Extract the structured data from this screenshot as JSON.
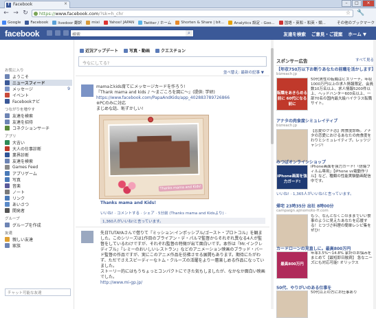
{
  "browser": {
    "tab_title": "Facebook",
    "url_prefix": "https://",
    "url_domain": "www.facebook.com",
    "url_path": "/?sk=h_chr",
    "bookmarks": [
      {
        "label": "Google",
        "color": "#4285f4"
      },
      {
        "label": "Facebook",
        "color": "#3b5998"
      },
      {
        "label": "livedoor 翻訳",
        "color": "#5aa0d8"
      },
      {
        "label": "mixi",
        "color": "#d89a3a"
      },
      {
        "label": "Yahoo! JAPAN",
        "color": "#d33"
      },
      {
        "label": "Twitter / ホーム",
        "color": "#5ab4e8"
      },
      {
        "label": "Shorten & Share | bit...",
        "color": "#e88a2a"
      },
      {
        "label": "Analytics 設定 - Goo...",
        "color": "#e6a200"
      },
      {
        "label": "国語・英和・和英・類...",
        "color": "#c33"
      }
    ],
    "other_bookmarks": "その他のブックマーク"
  },
  "header": {
    "logo": "facebook",
    "search_placeholder": "検索",
    "links": [
      "友達を検索",
      "ご意見・ご提案",
      "ホーム ▼"
    ]
  },
  "sidebar": {
    "section_favorites": "お気に入り",
    "favorites": [
      {
        "label": "ようこそ",
        "color": "#6d84b4"
      },
      {
        "label": "ニュースフィード",
        "color": "#3b5998",
        "selected": true
      },
      {
        "label": "メッセージ",
        "color": "#7b93c6",
        "count": "9"
      },
      {
        "label": "イベント",
        "color": "#c94a3a"
      },
      {
        "label": "Facebookナビ",
        "color": "#3b5998"
      }
    ],
    "section_connect": "つながりを増やす",
    "connect": [
      {
        "label": "友達を検索",
        "color": "#6d84b4"
      },
      {
        "label": "友達を招待",
        "color": "#6d84b4"
      },
      {
        "label": "コネクションサーチ",
        "color": "#5a8a3a"
      }
    ],
    "section_apps": "アプリ",
    "apps": [
      {
        "label": "大吉い",
        "color": "#2e8b57"
      },
      {
        "label": "大人の仕事診断",
        "color": "#c0392b"
      },
      {
        "label": "業界診断",
        "color": "#2f5597"
      },
      {
        "label": "友達を検索",
        "color": "#6d84b4"
      },
      {
        "label": "Games Feed",
        "color": "#8a8a8a"
      },
      {
        "label": "アプリゲーム",
        "color": "#4a7ab8"
      },
      {
        "label": "写真",
        "color": "#4a7ab8"
      },
      {
        "label": "音楽",
        "color": "#5a5a9a"
      },
      {
        "label": "ノート",
        "color": "#7a7a7a"
      },
      {
        "label": "リンク",
        "color": "#4a7ab8"
      },
      {
        "label": "あいさつ",
        "color": "#5a8ac8"
      },
      {
        "label": "開発者",
        "color": "#555"
      }
    ],
    "section_groups": "グループ",
    "groups": [
      {
        "label": "グループを作成",
        "color": "#6d84b4"
      }
    ],
    "section_friends": "友達",
    "friends": [
      {
        "label": "親しい友達",
        "color": "#e0a030"
      },
      {
        "label": "家族",
        "color": "#6d84b4"
      }
    ],
    "chat_placeholder": "チャット可能な友達"
  },
  "composer": {
    "tabs": [
      "近況アップデート",
      "写真・動画",
      "クエスチョン"
    ],
    "placeholder": "今なにしてる?",
    "sort_link": "並べ替え: 最新の記事 ▼"
  },
  "post1": {
    "line1": "mamaとkids育てにメッセージカードを作ろう!",
    "line2": "『Thank mama and kids ♪ 〜まごころを図に〜』(提供: 学研)",
    "link": "https://www.facebook.com/PapaAndKids/app_402883789726866",
    "line4": "※PCのみに対応",
    "line5": "まじめな話、恥ずかしい!",
    "photo_caption_text": "Thanks mama and Kids!",
    "photo_title": "Thanks mama and Kids!",
    "actions": "いいね! · コメントする · シェア · 5分前 (Thanks mama and Kidsより) ·",
    "likes": "1,360人がいいね!と言っています。"
  },
  "post2": {
    "paragraph": "先日TUTAYAさんで借りて『ミッション:インポッシブル/ゴースト・プロトコル』を観ました。このシリーズは1作目のブライアン・デ・パルマ監督からそれぞれ異なる4人が監督をしているわけですが、それぞれ監督の特徴が出て面白いです。本作は『Mr.インクレディブル』『レミーのおいしいレストラン』などのアニメーション映画のブラッド・バード監督の作品ですが、実にこのアニメ作品を彷彿させる展開もあります。期待にたがわず、ただでさえスピーディーなトム・クルーズの活躍をより一層楽しめる作品になっていました。",
    "paragraph2": "ストーリー的にはもうちょっとコンパクトにできた気もしましたが、なかなか面白い映画でした。",
    "link": "http://www.mi-gp.jp/"
  },
  "ads": {
    "header": "スポンサー広告",
    "see_all": "すべて見る",
    "items": [
      {
        "title": "【年収750万以下お断りあなたの前職を活かします】",
        "domain": "bizreach.jp",
        "banner": "転職をあきらめる前に 60代になる前に",
        "text": "50代男性の転職はビズリーチ。年収1000万円以上の求人情報限定、会員数10万名以上、求人情報5200件以上、ヘッドハンター600名以上、一部70名の国内最大級ハイクラス転職サイト。",
        "likes": ""
      },
      {
        "title": "アナタの肉食度シミュレイティブ",
        "domain": "bizreach.jp",
        "banner": "",
        "text": "【恋愛のクチ恋】肉食度診断。アナタの恋愛におけるあなたの肉食度をわりとシミュレイティブ。レッツジャンジ!",
        "likes": ""
      },
      {
        "title": "みつばオンラインショップ",
        "domain": "",
        "banner": "iPhone画面を強力ガード!",
        "text": "iPhone画面を強力ガード!「防傷フィルム専用」【iPhone vs電動作リル】など、種類の性能実験動画配信中です。",
        "likes": "いいね! · 1,365人がいいね!と言っています。"
      },
      {
        "title": "帰宅 23時35分 出社 8時00分",
        "domain": "campaign.ajinomoto-ff.com",
        "banner": "",
        "text": "もう、なんとなくこのままでいい食事のように見えたあなたを応援する！とつづさ料理の簡単レシピ集をぜひ!",
        "likes": ""
      },
      {
        "title": "カードローンの見直しに。最高800万円",
        "domain": "",
        "banner": "最高800万円",
        "text": "年率3.5%〜14.8% 家計のお悩みをまとめて【最短即日融資】 急なニーズにも対応可能! オリックス",
        "likes": ""
      },
      {
        "title": "50代、やりがいのある仕事を",
        "domain": "",
        "banner": "",
        "text": "50代以上の方にお仕事あり",
        "likes": ""
      }
    ]
  }
}
